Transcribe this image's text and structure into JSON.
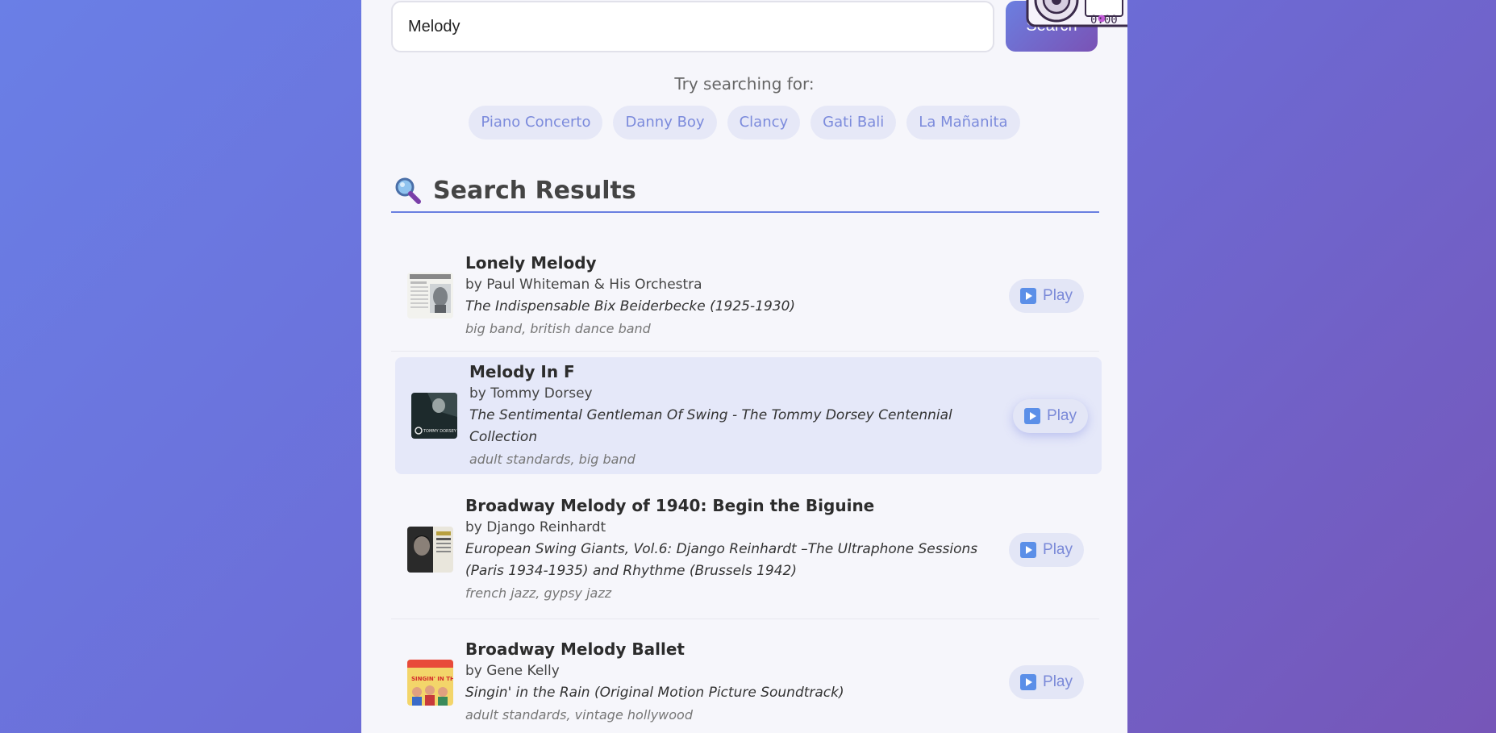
{
  "search": {
    "value": "Melody",
    "button_label": "Search",
    "boombox_display": "0:00"
  },
  "suggestions": {
    "title": "Try searching for:",
    "chips": [
      "Piano Concerto",
      "Danny Boy",
      "Clancy",
      "Gati Bali",
      "La Mañanita"
    ]
  },
  "results": {
    "heading_icon": "magnifier-icon",
    "heading": "Search Results",
    "play_label": "Play",
    "items": [
      {
        "title": "Lonely Melody",
        "artist": "by Paul Whiteman & His Orchestra",
        "album": "The Indispensable Bix Beiderbecke (1925-1930)",
        "genres": "big band, british dance band"
      },
      {
        "title": "Melody In F",
        "artist": "by Tommy Dorsey",
        "album": "The Sentimental Gentleman Of Swing - The Tommy Dorsey Centennial Collection",
        "genres": "adult standards, big band",
        "cover_text": "TOMMY DORSEY"
      },
      {
        "title": "Broadway Melody of 1940: Begin the Biguine",
        "artist": "by Django Reinhardt",
        "album": "European Swing Giants, Vol.6: Django Reinhardt –The Ultraphone Sessions (Paris 1934-1935) and Rhythme (Brussels 1942)",
        "genres": "french jazz, gypsy jazz"
      },
      {
        "title": "Broadway Melody Ballet",
        "artist": "by Gene Kelly",
        "album": "Singin' in the Rain (Original Motion Picture Soundtrack)",
        "genres": "adult standards, vintage hollywood",
        "cover_text": "SINGIN' IN THE RAIN"
      }
    ]
  },
  "colors": {
    "accent": "#6a7fe0",
    "highlight_row": "#e5e8f9",
    "chip_bg": "#e6e8f7",
    "play_icon": "#5b8fe8"
  }
}
